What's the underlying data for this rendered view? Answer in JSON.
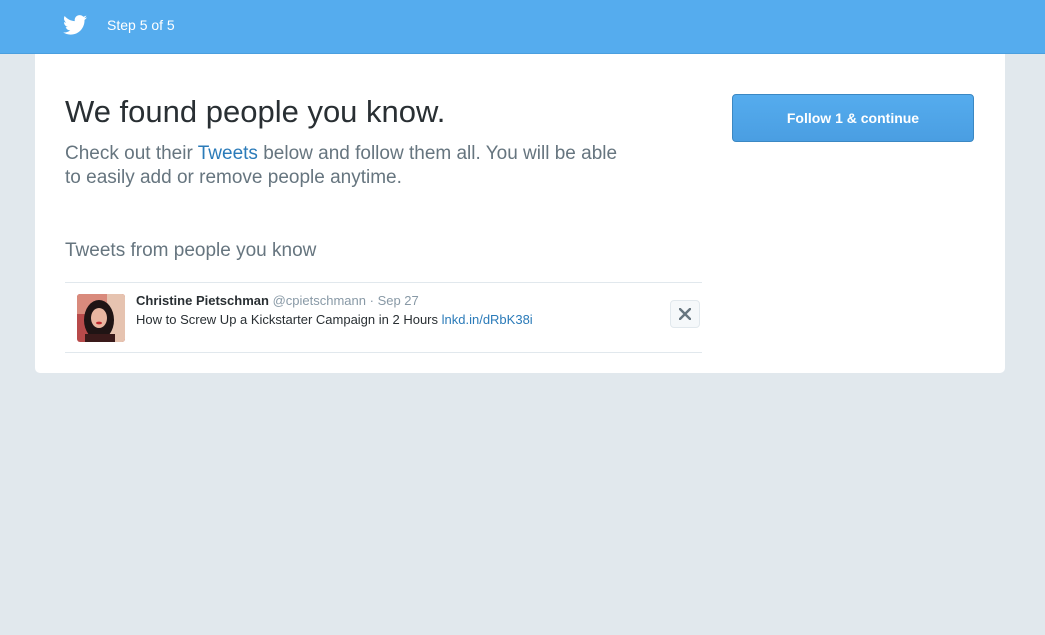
{
  "topbar": {
    "logo_icon": "twitter-bird-icon",
    "step_label": "Step 5 of 5",
    "bg_color": "#55acee"
  },
  "main": {
    "headline": "We found people you know.",
    "subtext_before": "Check out their ",
    "subtext_link": "Tweets",
    "subtext_after": " below and follow them all. You will be able to easily add or remove people anytime.",
    "follow_button_label": "Follow 1 & continue",
    "section_title": "Tweets from people you know"
  },
  "tweets": [
    {
      "fullname": "Christine Pietschman",
      "username": "@cpietschmann",
      "separator": "·",
      "time": "Sep 27",
      "text": "How to Screw Up a Kickstarter Campaign in 2 Hours ",
      "link": "lnkd.in/dRbK38i",
      "dismiss_icon": "close-icon"
    }
  ],
  "colors": {
    "accent": "#55acee",
    "link": "#2b7bb9",
    "page_bg": "#e1e8ed",
    "muted_text": "#66757f"
  }
}
